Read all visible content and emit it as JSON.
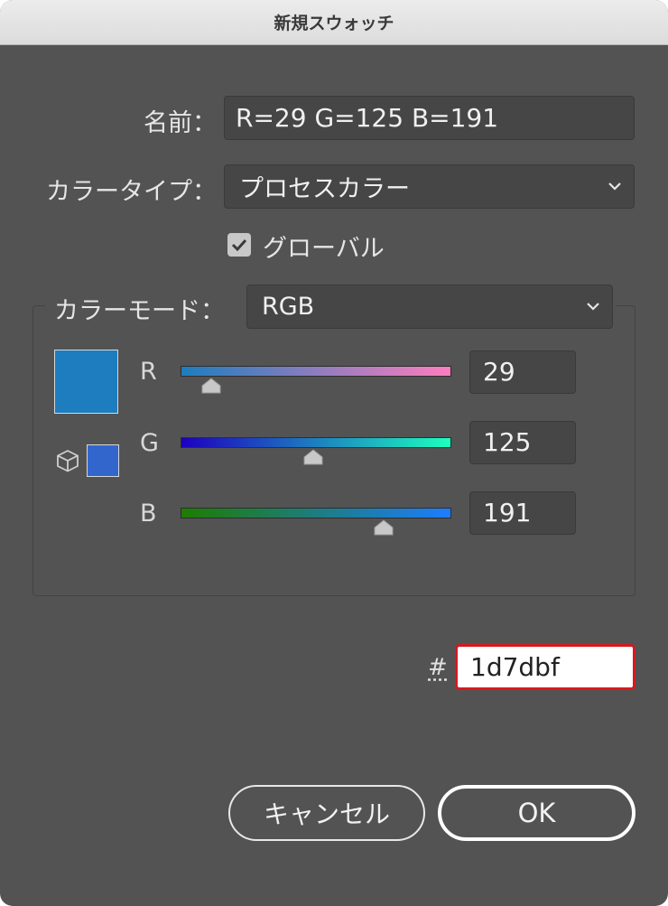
{
  "window": {
    "title": "新規スウォッチ"
  },
  "name": {
    "label": "名前：",
    "value": "R=29 G=125 B=191"
  },
  "color_type": {
    "label": "カラータイプ：",
    "selected": "プロセスカラー"
  },
  "global": {
    "label": "グローバル",
    "checked": true
  },
  "color_mode": {
    "label": "カラーモード：",
    "selected": "RGB"
  },
  "swatch": {
    "color": "#1d7dbf",
    "web_safe_color": "#3366cc"
  },
  "channels": [
    {
      "label": "R",
      "value": "29",
      "fraction": 0.1137,
      "gradient": [
        "#1d7dbf",
        "#ff7dbf"
      ]
    },
    {
      "label": "G",
      "value": "125",
      "fraction": 0.4902,
      "gradient": [
        "#1d00bf",
        "#1dffbf"
      ]
    },
    {
      "label": "B",
      "value": "191",
      "fraction": 0.749,
      "gradient": [
        "#1d7d00",
        "#1d7dff"
      ]
    }
  ],
  "hex": {
    "label": "#",
    "value": "1d7dbf"
  },
  "buttons": {
    "cancel": "キャンセル",
    "ok": "OK"
  },
  "colors": {
    "dialog_bg": "#535353",
    "hex_focus_border": "#d7191f"
  }
}
